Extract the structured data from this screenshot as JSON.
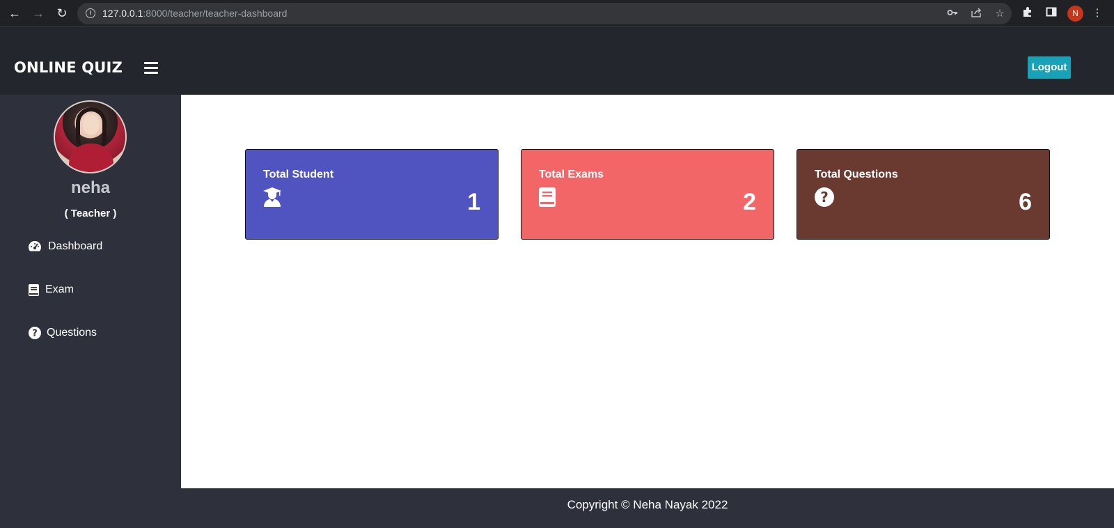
{
  "browser": {
    "url_host": "127.0.0.1",
    "url_path": ":8000/teacher/teacher-dashboard",
    "profile_initial": "N"
  },
  "header": {
    "brand": "ONLINE QUIZ",
    "logout_label": "Logout",
    "logout_color": "#17a2b8"
  },
  "sidebar": {
    "name": "neha",
    "role": "( Teacher )",
    "items": [
      {
        "label": "Dashboard",
        "icon": "speedometer-icon"
      },
      {
        "label": "Exam",
        "icon": "book-icon"
      },
      {
        "label": "Questions",
        "icon": "question-circle-icon"
      }
    ]
  },
  "cards": [
    {
      "title": "Total Student",
      "value": "1",
      "icon": "graduate-user-icon",
      "color": "#4f54c0"
    },
    {
      "title": "Total Exams",
      "value": "2",
      "icon": "book-icon",
      "color": "#f26668"
    },
    {
      "title": "Total Questions",
      "value": "6",
      "icon": "question-circle-icon",
      "color": "#6a3a30"
    }
  ],
  "footer": {
    "text": "Copyright © Neha Nayak 2022"
  }
}
